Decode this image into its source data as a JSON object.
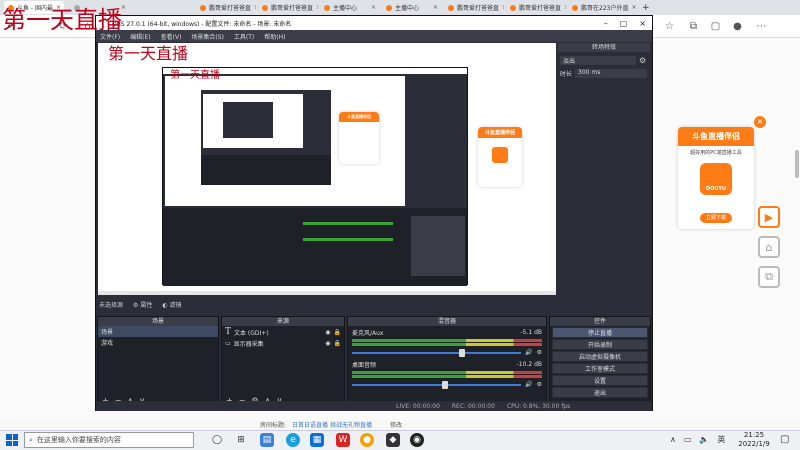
{
  "watermark": {
    "text": "第一天直播"
  },
  "browser": {
    "tabs": [
      {
        "label": "斗鱼 - 国内最"
      },
      {
        "label": ""
      },
      {
        "label": "鹏哥爱打爸爸直"
      },
      {
        "label": "鹏哥爱打爸爸直"
      },
      {
        "label": "主播中心"
      },
      {
        "label": "主播中心"
      },
      {
        "label": "鹏哥爱打爸爸直"
      },
      {
        "label": "鹏哥爱打爸爸直"
      },
      {
        "label": "鹏哥在223户外直"
      }
    ],
    "new_tab": "+"
  },
  "obs": {
    "title": "OBS 27.0.1 (64-bit, windows) - 配置文件: 未命名 - 场景: 未命名",
    "menu": [
      "文件(F)",
      "编辑(E)",
      "查看(V)",
      "场景集合(S)",
      "工具(T)",
      "帮助(H)"
    ],
    "transitions": {
      "header": "转场特效",
      "type": "淡出",
      "duration_label": "时长",
      "duration_value": "300 ms"
    },
    "source_bar": {
      "none_selected": "未选择源",
      "props": "属性",
      "filters": "滤镜"
    },
    "scenes": {
      "header": "场景",
      "items": [
        "场景",
        "游戏"
      ]
    },
    "sources": {
      "header": "来源",
      "items": [
        "文本 (GDI+)",
        "显示器采集"
      ]
    },
    "mixer": {
      "header": "混音器",
      "channels": [
        {
          "name": "麦克风/Aux",
          "db": "-5.1 dB",
          "level": 0.65
        },
        {
          "name": "桌面音频",
          "db": "-10.2 dB",
          "level": 0.55
        }
      ],
      "scale": [
        "-60",
        "-55",
        "-50",
        "-45",
        "-40",
        "-35",
        "-30",
        "-25",
        "-20",
        "-15",
        "-10",
        "-5",
        "0"
      ]
    },
    "controls": {
      "header": "控件",
      "buttons": [
        "停止直播",
        "开始录制",
        "启动虚拟摄像机",
        "工作室模式",
        "设置",
        "退出"
      ]
    },
    "status": {
      "live": "LIVE: 00:00:00",
      "rec": "REC: 00:00:00",
      "cpu": "CPU: 0.8%, 30.00 fps"
    }
  },
  "promo": {
    "title": "斗鱼直播伴侣",
    "subtitle": "超好用的PC端直播工具",
    "logo_text": "DOUYU",
    "button": "立即下载",
    "close": "×"
  },
  "page_footer": {
    "text": "房间标题:",
    "link": "日首日语直播 挑战无礼物直播",
    "edit": "修改"
  },
  "taskbar": {
    "search_placeholder": "在这里输入你要搜索的内容",
    "time": "21:25",
    "date": "2022/1/9"
  },
  "colors": {
    "accent": "#ff7b15",
    "watermark": "#c00018",
    "obs_bg": "#2b2e38"
  }
}
